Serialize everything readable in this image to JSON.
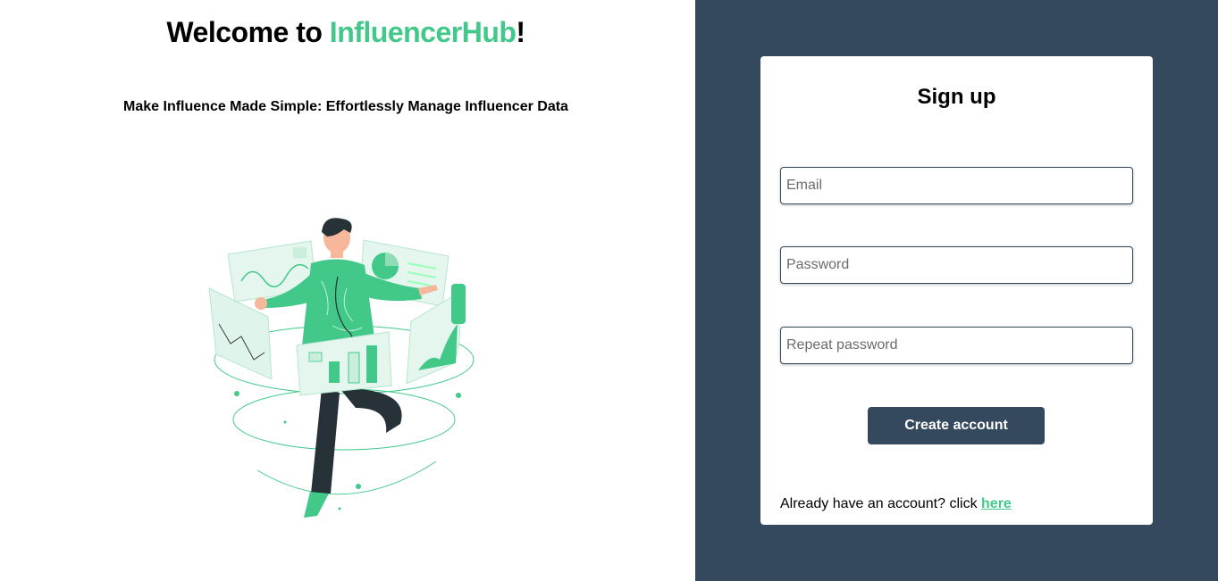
{
  "hero": {
    "welcome_prefix": "Welcome to ",
    "brand": "InfluencerHub",
    "welcome_suffix": "!",
    "tagline": "Make Influence Made Simple: Effortlessly Manage Influencer Data"
  },
  "signup": {
    "title": "Sign up",
    "email_placeholder": "Email",
    "password_placeholder": "Password",
    "repeat_password_placeholder": "Repeat password",
    "create_button": "Create account",
    "login_prompt": "Already have an account? click ",
    "login_link": "here"
  },
  "colors": {
    "brand_green": "#42c98a",
    "panel_navy": "#34495e",
    "background": "#ffffff"
  }
}
